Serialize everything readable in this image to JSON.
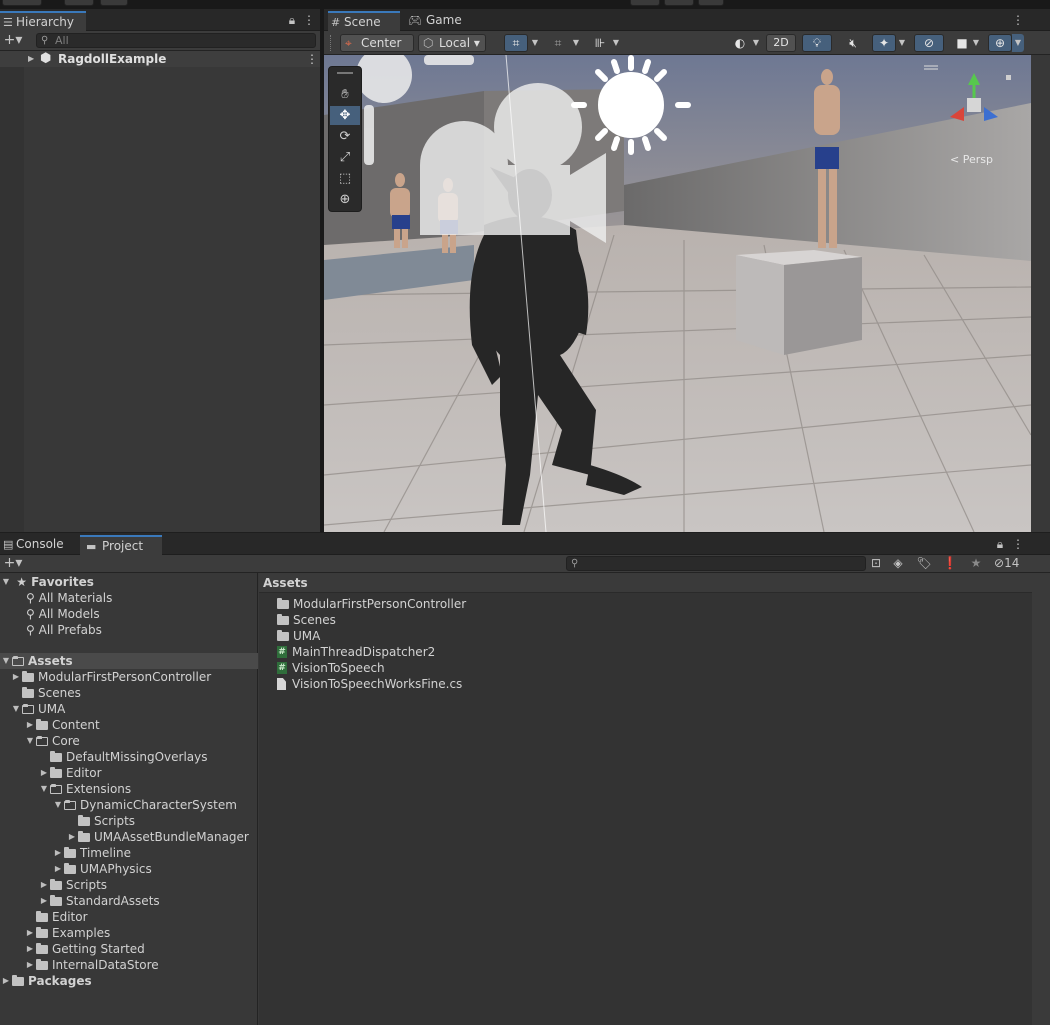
{
  "hierarchy": {
    "tab_label": "Hierarchy",
    "search_placeholder": "All",
    "scene_item": "RagdollExample"
  },
  "scene_panel": {
    "tabs": [
      "Scene",
      "Game"
    ],
    "pivot_mode": "Center",
    "pivot_rotation": "Local",
    "mode_2d": "2D",
    "gizmo_label": "< Persp"
  },
  "tools": [
    "hand-tool",
    "move-tool",
    "rotate-tool",
    "scale-tool",
    "rect-tool",
    "transform-tool"
  ],
  "bottom_panel": {
    "tabs": [
      "Console",
      "Project"
    ],
    "hidden_count": "14",
    "breadcrumb": "Assets"
  },
  "favorites": {
    "label": "Favorites",
    "items": [
      "All Materials",
      "All Models",
      "All Prefabs"
    ]
  },
  "tree": {
    "assets_label": "Assets",
    "packages_label": "Packages",
    "items": [
      "ModularFirstPersonController",
      "Scenes",
      "UMA",
      "Content",
      "Core",
      "DefaultMissingOverlays",
      "Editor",
      "Extensions",
      "DynamicCharacterSystem",
      "Scripts",
      "UMAAssetBundleManager",
      "Timeline",
      "UMAPhysics",
      "Scripts",
      "StandardAssets",
      "Editor",
      "Examples",
      "Getting Started",
      "InternalDataStore"
    ]
  },
  "grid": {
    "items": [
      "ModularFirstPersonController",
      "Scenes",
      "UMA",
      "MainThreadDispatcher2",
      "VisionToSpeech",
      "VisionToSpeechWorksFine.cs"
    ]
  },
  "colors": {
    "accent_blue": "#46607c",
    "tab_highlight": "#3a79bb",
    "script_green": "#2f6e3b"
  }
}
